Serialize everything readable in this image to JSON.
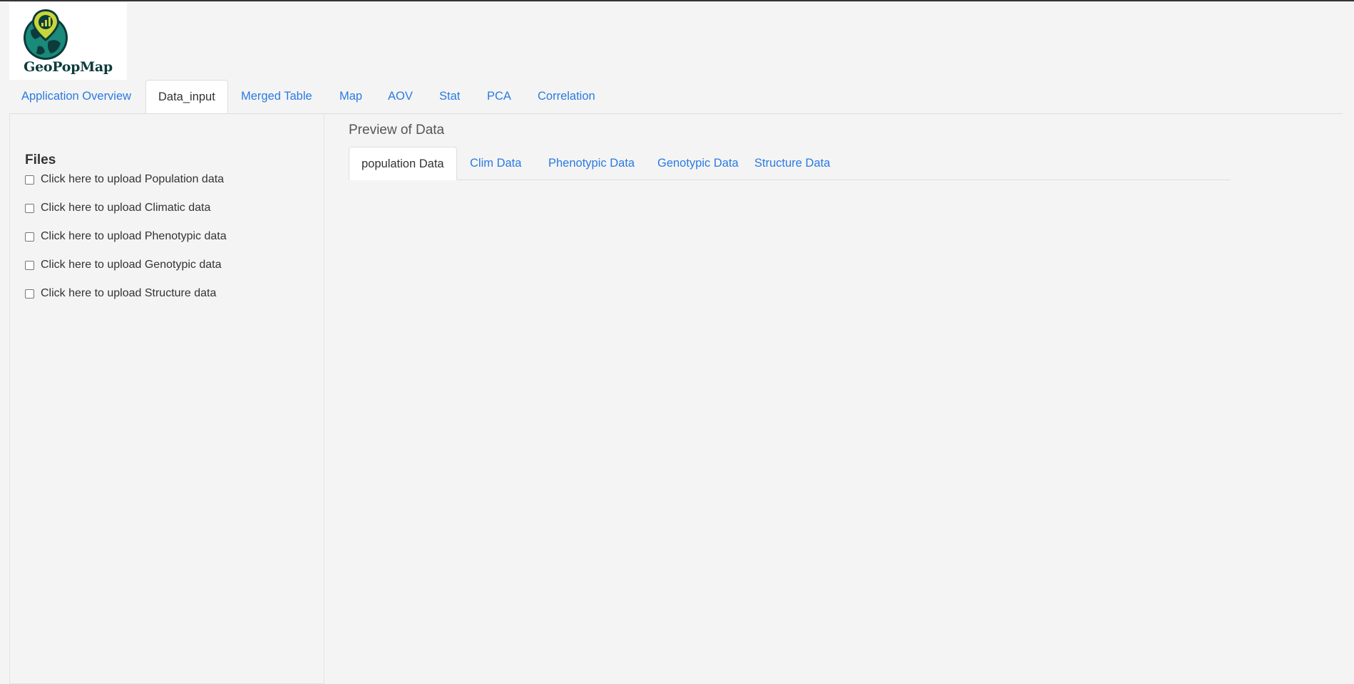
{
  "app": {
    "logo_text": "GeoPopMap"
  },
  "nav": {
    "tabs": [
      {
        "label": "Application Overview",
        "active": false
      },
      {
        "label": "Data_input",
        "active": true
      },
      {
        "label": "Merged Table",
        "active": false
      },
      {
        "label": "Map",
        "active": false
      },
      {
        "label": "AOV",
        "active": false
      },
      {
        "label": "Stat",
        "active": false
      },
      {
        "label": "PCA",
        "active": false
      },
      {
        "label": "Correlation",
        "active": false
      }
    ]
  },
  "sidebar": {
    "heading": "Files",
    "checkboxes": [
      {
        "label": "Click here to upload Population data",
        "checked": false
      },
      {
        "label": "Click here to upload Climatic data",
        "checked": false
      },
      {
        "label": "Click here to upload Phenotypic data",
        "checked": false
      },
      {
        "label": "Click here to upload Genotypic data",
        "checked": false
      },
      {
        "label": "Click here to upload Structure data",
        "checked": false
      }
    ]
  },
  "main": {
    "title": "Preview of Data",
    "tabs": [
      {
        "label": "population Data",
        "active": true
      },
      {
        "label": "Clim Data",
        "active": false
      },
      {
        "label": "Phenotypic Data",
        "active": false
      },
      {
        "label": "Genotypic Data",
        "active": false
      },
      {
        "label": "Structure Data",
        "active": false
      }
    ]
  },
  "colors": {
    "link": "#2a7ae2",
    "background": "#f4f4f4",
    "logo_teal": "#1a8a7a",
    "logo_dark": "#0d3b3b",
    "logo_pin": "#c8d63a"
  }
}
